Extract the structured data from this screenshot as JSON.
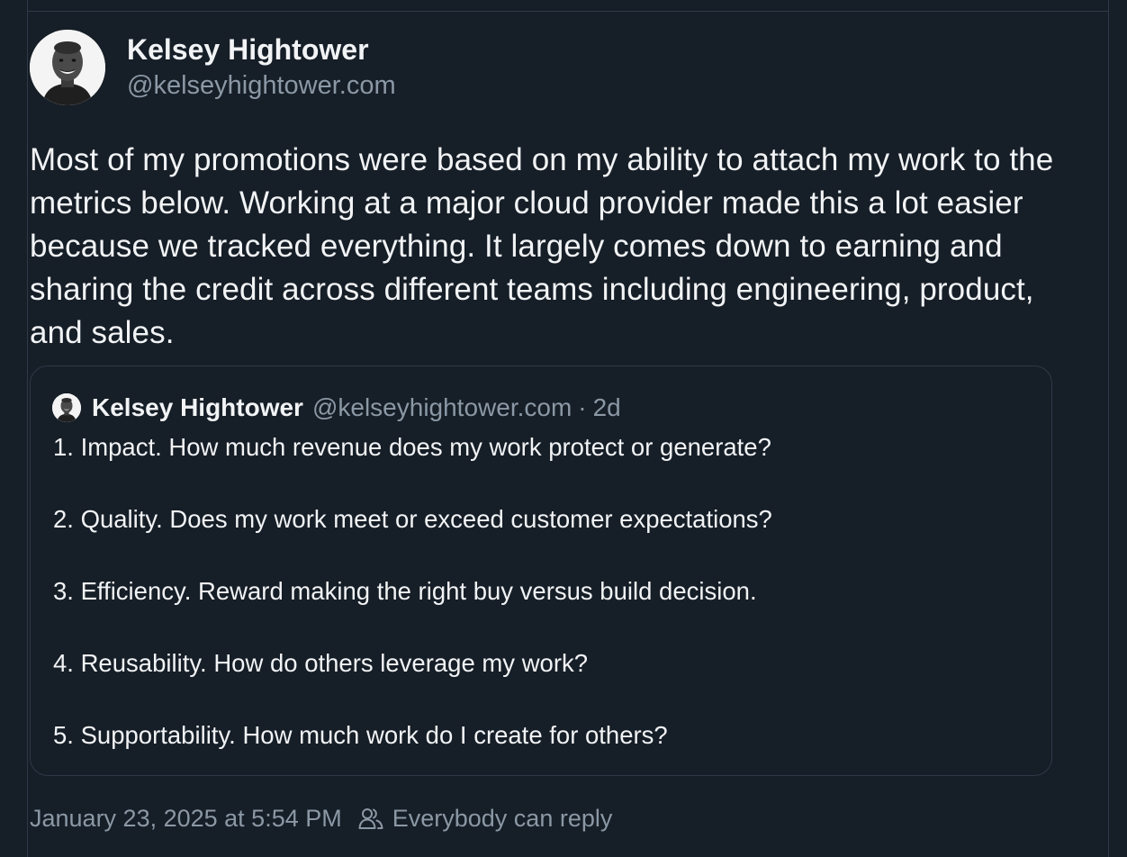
{
  "post": {
    "author": {
      "display_name": "Kelsey Hightower",
      "handle": "@kelseyhightower.com",
      "avatar_icon": "avatar-photo"
    },
    "text": "Most of my promotions were based on my ability to attach my work to the metrics below. Working at a major cloud provider made this a lot easier because we tracked everything. It largely comes down to earning and sharing the credit across different teams including engineering, product, and sales.",
    "quote": {
      "display_name": "Kelsey Hightower",
      "handle": "@kelseyhightower.com",
      "separator": "·",
      "time": "2d",
      "lines": [
        "1. Impact. How much revenue does my work protect or generate?",
        "2. Quality. Does my work meet or exceed customer expectations?",
        "3. Efficiency. Reward making the right buy versus build decision.",
        "4. Reusability. How do others leverage my work?",
        "5. Supportability. How much work do I create for others?"
      ]
    },
    "footer": {
      "timestamp": "January 23, 2025 at 5:54 PM",
      "reply_setting": "Everybody can reply",
      "reply_icon": "people-icon"
    }
  },
  "colors": {
    "background": "#161e27",
    "border": "#2e3a48",
    "text_primary": "#f1f3f5",
    "text_secondary": "#8b98a5"
  }
}
